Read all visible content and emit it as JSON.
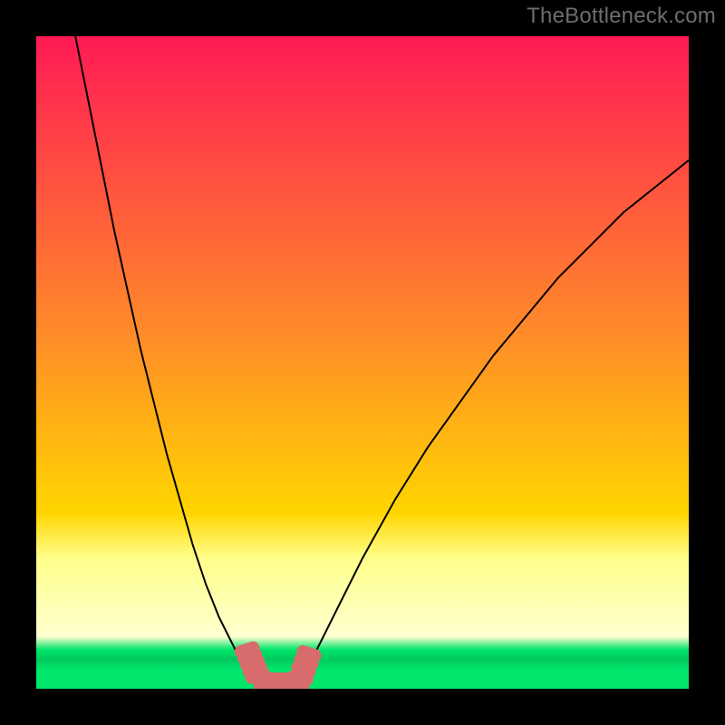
{
  "watermark": "TheBottleneck.com",
  "colors": {
    "frame": "#000000",
    "watermark": "#6d6d6d",
    "gradient_top": "#ff1a55",
    "gradient_mid": "#ffd500",
    "gradient_low": "#ffff8a",
    "gradient_green": "#00e66b",
    "curve": "#000000",
    "marker": "#d86c6c"
  },
  "chart_data": {
    "type": "line",
    "title": "",
    "xlabel": "",
    "ylabel": "",
    "xlim": [
      0,
      100
    ],
    "ylim": [
      0,
      100
    ],
    "series": [
      {
        "name": "left-branch",
        "x": [
          6,
          8,
          10,
          12,
          14,
          16,
          18,
          20,
          22,
          24,
          26,
          28,
          30,
          31,
          32,
          33,
          34
        ],
        "y": [
          100,
          90,
          80,
          70,
          61,
          52,
          44,
          36,
          29,
          22,
          16,
          11,
          7,
          5,
          3,
          1.5,
          0.5
        ]
      },
      {
        "name": "right-branch",
        "x": [
          40,
          41,
          42,
          44,
          46,
          50,
          55,
          60,
          65,
          70,
          75,
          80,
          85,
          90,
          95,
          100
        ],
        "y": [
          0.5,
          2,
          4,
          8,
          12,
          20,
          29,
          37,
          44,
          51,
          57,
          63,
          68,
          73,
          77,
          81
        ]
      },
      {
        "name": "floor",
        "x": [
          34,
          36,
          38,
          40
        ],
        "y": [
          0.5,
          0.3,
          0.3,
          0.5
        ]
      }
    ],
    "markers": {
      "name": "highlight-band",
      "x": [
        32.3,
        32.7,
        33.1,
        33.5,
        33.9,
        34.3,
        35.0,
        36.0,
        37.0,
        38.0,
        39.0,
        40.0,
        40.6,
        41.0,
        41.4,
        41.8
      ],
      "y": [
        6.0,
        5.0,
        4.0,
        3.0,
        2.0,
        1.2,
        0.8,
        0.6,
        0.6,
        0.6,
        0.7,
        0.9,
        1.8,
        3.0,
        4.2,
        5.4
      ]
    },
    "gradient_stops_pct": [
      0,
      45,
      73,
      80,
      92,
      94,
      95.5,
      97,
      100
    ],
    "legend": []
  }
}
